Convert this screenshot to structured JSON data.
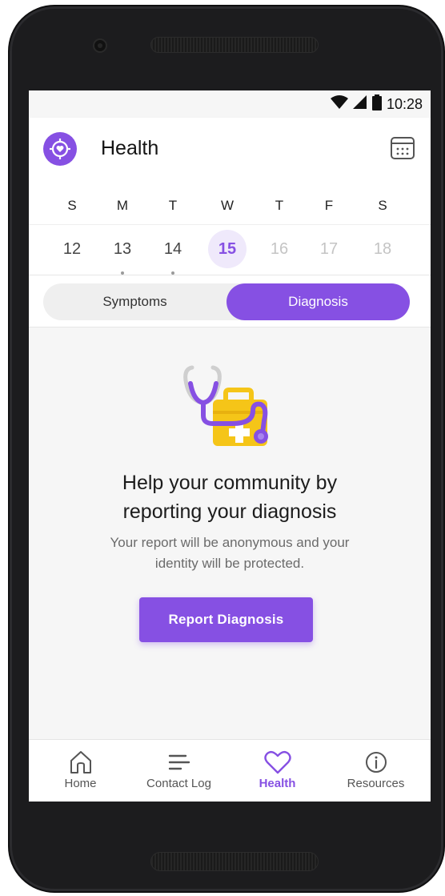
{
  "status_bar": {
    "time": "10:28"
  },
  "header": {
    "title": "Health"
  },
  "week": {
    "weekdays": [
      "S",
      "M",
      "T",
      "W",
      "T",
      "F",
      "S"
    ],
    "dates": [
      "12",
      "13",
      "14",
      "15",
      "16",
      "17",
      "18"
    ],
    "selected_date": "15"
  },
  "tabs": {
    "symptoms": "Symptoms",
    "diagnosis": "Diagnosis",
    "active": "Diagnosis"
  },
  "main": {
    "headline_line1": "Help your community by",
    "headline_line2": "reporting your diagnosis",
    "subtext_line1": "Your report will be anonymous and your",
    "subtext_line2": "identity will be protected.",
    "button_label": "Report Diagnosis"
  },
  "nav": {
    "items": [
      {
        "label": "Home",
        "icon": "home-icon"
      },
      {
        "label": "Contact Log",
        "icon": "list-icon"
      },
      {
        "label": "Health",
        "icon": "heart-icon"
      },
      {
        "label": "Resources",
        "icon": "info-icon"
      }
    ],
    "active": "Health"
  },
  "colors": {
    "accent": "#8650e3",
    "accent_light": "#efe9fb",
    "kit_yellow": "#f5c518"
  }
}
